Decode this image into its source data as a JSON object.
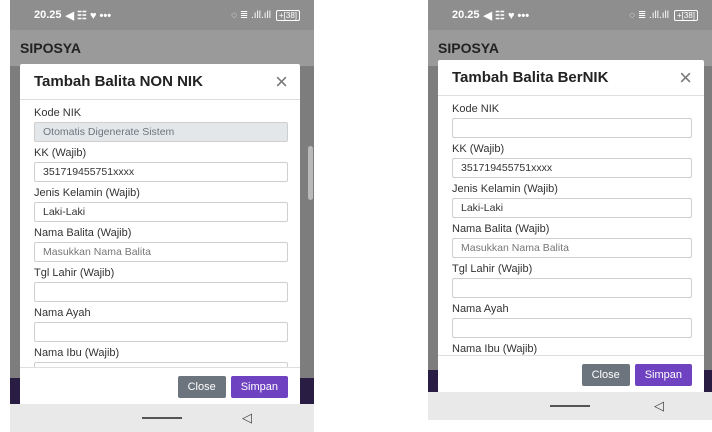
{
  "colors": {
    "primary": "#6f42c1",
    "secondary": "#6c757d",
    "overlay": "#7d7d7d"
  },
  "screens": [
    {
      "status": {
        "time": "20.25",
        "icons": "◀ ☷ ♥ •••",
        "signal": "◌ ≣ .ıll.ıll",
        "battery": "+[38]"
      },
      "app_title": "SIPOSYA",
      "modal": {
        "title": "Tambah Balita NON NIK",
        "fields": [
          {
            "label": "Kode NIK",
            "value": "Otomatis Digenerate Sistem",
            "placeholder": ""
          },
          {
            "label": "KK (Wajib)",
            "value": "351719455751xxxx",
            "placeholder": ""
          },
          {
            "label": "Jenis Kelamin (Wajib)",
            "value": "Laki-Laki",
            "placeholder": ""
          },
          {
            "label": "Nama Balita (Wajib)",
            "value": "",
            "placeholder": "Masukkan Nama Balita"
          },
          {
            "label": "Tgl Lahir (Wajib)",
            "value": "",
            "placeholder": ""
          },
          {
            "label": "Nama Ayah",
            "value": "",
            "placeholder": ""
          },
          {
            "label": "Nama Ibu (Wajib)",
            "value": "",
            "placeholder": ""
          }
        ],
        "close_label": "Close",
        "save_label": "Simpan"
      }
    },
    {
      "status": {
        "time": "20.25",
        "icons": "◀ ☷ ♥ •••",
        "signal": "◌ ≣ .ıll.ıll",
        "battery": "+[38]"
      },
      "app_title": "SIPOSYA",
      "modal": {
        "title": "Tambah Balita BerNIK",
        "fields": [
          {
            "label": "Kode NIK",
            "value": "",
            "placeholder": ""
          },
          {
            "label": "KK (Wajib)",
            "value": "351719455751xxxx",
            "placeholder": ""
          },
          {
            "label": "Jenis Kelamin (Wajib)",
            "value": "Laki-Laki",
            "placeholder": ""
          },
          {
            "label": "Nama Balita (Wajib)",
            "value": "",
            "placeholder": "Masukkan Nama Balita"
          },
          {
            "label": "Tgl Lahir (Wajib)",
            "value": "",
            "placeholder": ""
          },
          {
            "label": "Nama Ayah",
            "value": "",
            "placeholder": ""
          },
          {
            "label": "Nama Ibu (Wajib)",
            "value": "",
            "placeholder": ""
          }
        ],
        "close_label": "Close",
        "save_label": "Simpan"
      }
    }
  ]
}
